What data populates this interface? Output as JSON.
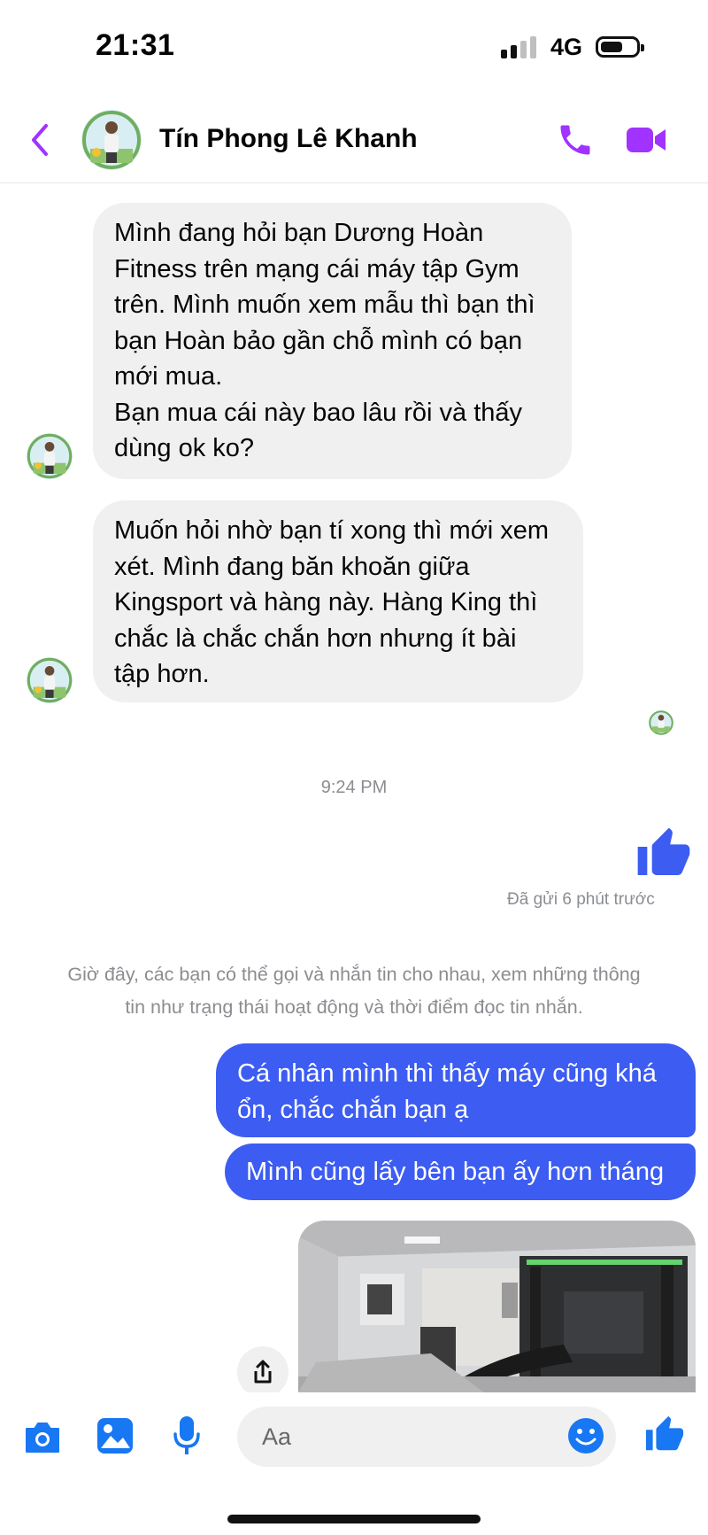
{
  "status_bar": {
    "time": "21:31",
    "network": "4G"
  },
  "header": {
    "contact_name": "Tín Phong Lê Khanh"
  },
  "messages_in": [
    {
      "text": "Mình đang hỏi bạn Dương Hoàn\nFitness trên mạng cái máy tập Gym\ntrên. Mình muốn xem mẫu thì bạn thì\nbạn Hoàn bảo gần chỗ mình có bạn\nmới mua.\nBạn mua cái này bao lâu rồi và thấy\ndùng ok ko?"
    },
    {
      "text": "Muốn hỏi nhờ bạn tí xong thì mới xem\nxét. Mình đang băn khoăn giữa\nKingsport và hàng này. Hàng King thì\nchắc là chắc chắn hơn nhưng ít bài\ntập hơn."
    }
  ],
  "timestamp": "9:24 PM",
  "sent_status": "Đã gửi 6 phút trước",
  "system_note": "Giờ đây, các bạn có thể gọi và nhắn tin cho nhau, xem những thông\ntin như trạng thái hoạt động và thời điểm đọc tin nhắn.",
  "messages_out": [
    {
      "text": "Cá nhân mình thì thấy máy cũng khá\nổn, chắc chắn bạn ạ"
    },
    {
      "text": "Mình cũng lấy bên bạn ấy hơn tháng"
    }
  ],
  "composer": {
    "placeholder": "Aa"
  },
  "colors": {
    "accent": "#a033ff",
    "outgoing_bubble": "#3c5cf2",
    "incoming_bubble": "#f0f0f0",
    "icon_blue": "#1877f2"
  },
  "icons": [
    "back-icon",
    "phone-icon",
    "video-icon",
    "like-icon",
    "share-icon",
    "camera-icon",
    "gallery-icon",
    "microphone-icon",
    "emoji-icon"
  ]
}
